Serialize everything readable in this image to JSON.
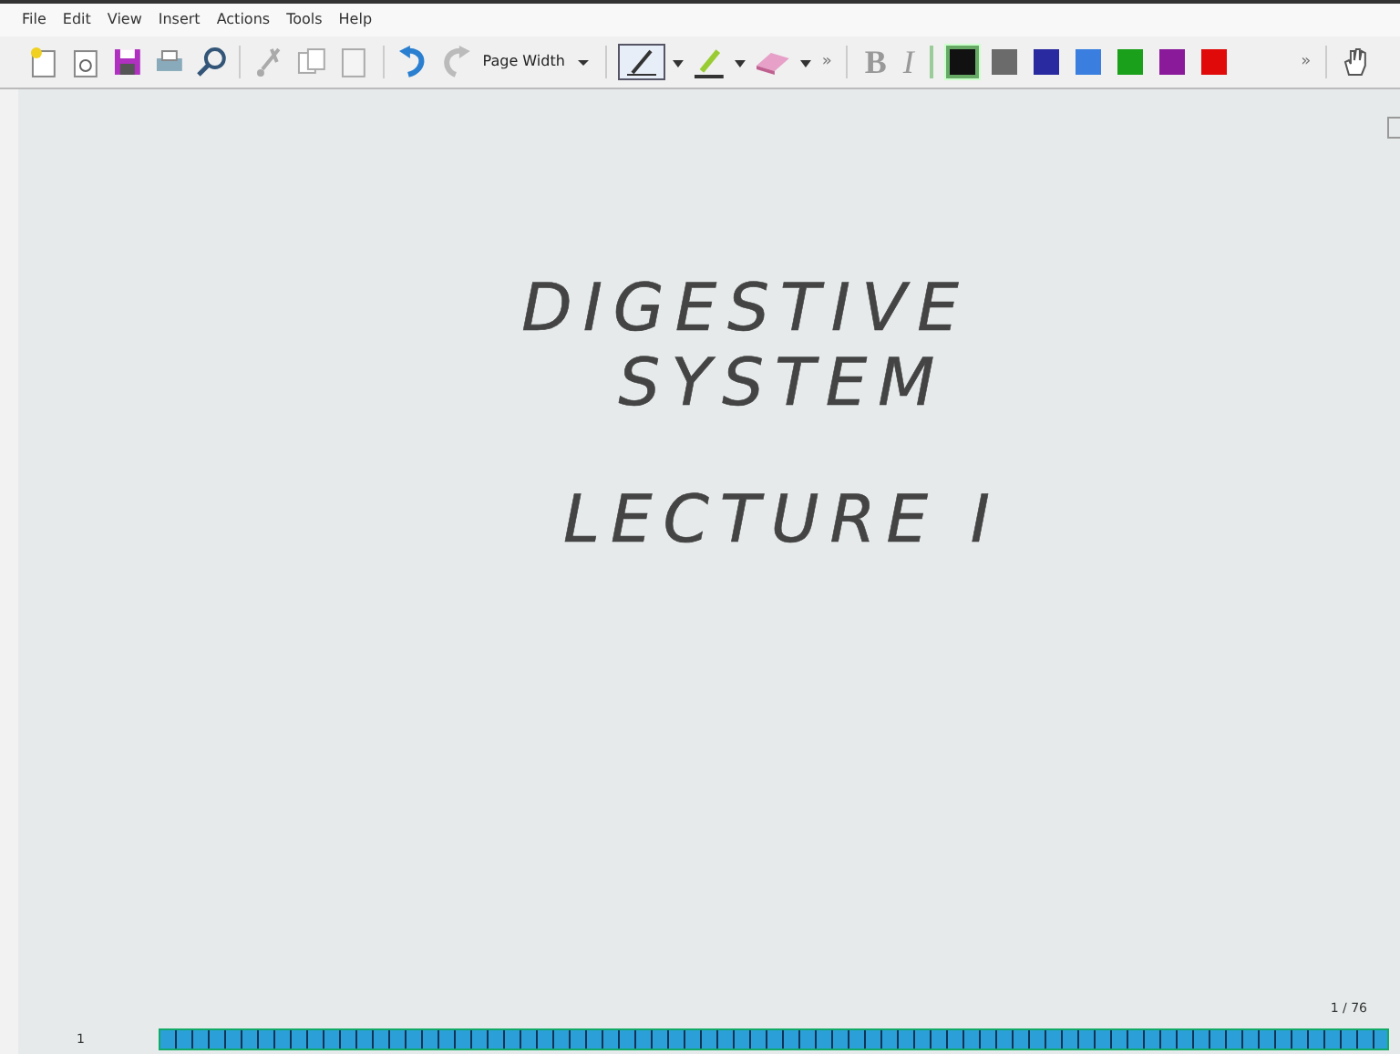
{
  "menu": [
    "File",
    "Edit",
    "View",
    "Insert",
    "Actions",
    "Tools",
    "Help"
  ],
  "toolbar": {
    "zoom": "Page Width",
    "more_1": "»",
    "more_2": "»",
    "bold": "B",
    "italic": "I",
    "colors": [
      {
        "color": "#111111",
        "selected": true
      },
      {
        "color": "#6b6b6b",
        "selected": false
      },
      {
        "color": "#2a2aa0",
        "selected": false
      },
      {
        "color": "#3a7fe0",
        "selected": false
      },
      {
        "color": "#1aa01a",
        "selected": false
      },
      {
        "color": "#8a1a9a",
        "selected": false
      },
      {
        "color": "#e00a0a",
        "selected": false
      }
    ]
  },
  "page": {
    "lines": [
      "DIGESTIVE",
      "SYSTEM",
      "LECTURE I"
    ]
  },
  "footer": {
    "page_number": "1 / 76",
    "row_label": "1"
  }
}
